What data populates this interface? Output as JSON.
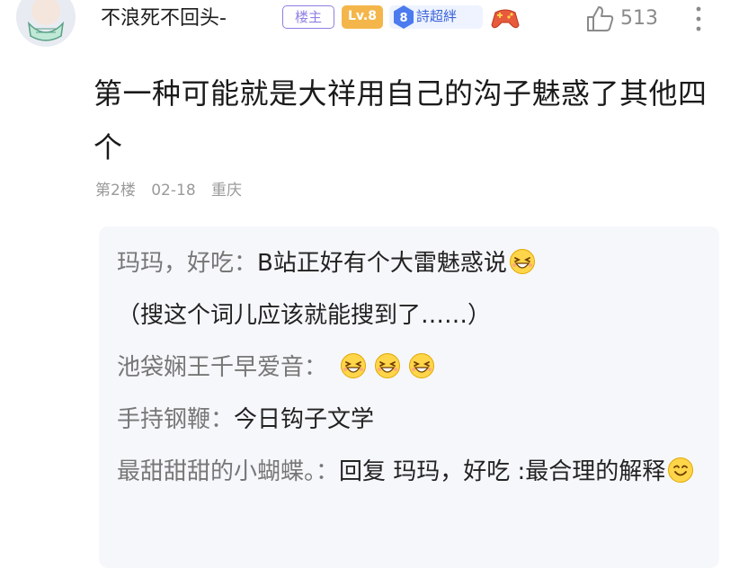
{
  "post": {
    "username": "不浪死不回头-",
    "badges": {
      "owner": "楼主",
      "level": "Lv.8",
      "fan_level": "8",
      "fan_name": "詩超絆"
    },
    "likes": "513",
    "content": "第一种可能就是大祥用自己的沟子魅惑了其他四个",
    "meta": {
      "floor": "第2楼",
      "date": "02-18",
      "location": "重庆"
    },
    "icons": {
      "avatar": "avatar-image",
      "game": "gamepad-icon",
      "like": "thumbs-up-icon",
      "more": "more-vertical-icon",
      "emoji": "laughing-emoji"
    }
  },
  "replies": [
    {
      "author": "玛玛，好吃：",
      "text": "B站正好有个大雷魅惑说",
      "continuation": "（搜这个词儿应该就能搜到了……）"
    },
    {
      "author": "池袋娴王千早爱音：",
      "text": ""
    },
    {
      "author": "手持钢鞭：",
      "text": "今日钩子文学"
    },
    {
      "author": "最甜甜甜的小蝴蝶。：",
      "text": "回复 玛玛，好吃 :最合理的解释"
    }
  ],
  "colors": {
    "accent_purple": "#8f7fe3",
    "level_orange": "#f4b64a",
    "fan_blue": "#3b63d8",
    "reply_bg": "#f6f7fb"
  }
}
